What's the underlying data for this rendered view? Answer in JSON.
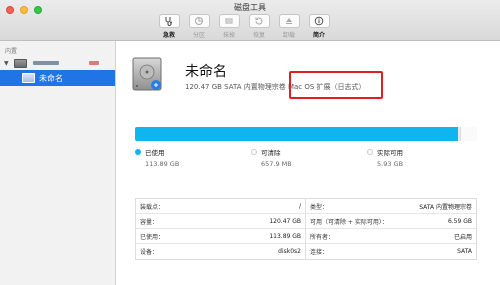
{
  "app": {
    "title": "磁盘工具"
  },
  "toolbar": {
    "buttons": [
      {
        "label": "急救",
        "icon": "stethoscope-icon",
        "enabled": true
      },
      {
        "label": "分区",
        "icon": "pie-chart-icon",
        "enabled": false
      },
      {
        "label": "抹掉",
        "icon": "erase-icon",
        "enabled": false
      },
      {
        "label": "恢复",
        "icon": "restore-icon",
        "enabled": false
      },
      {
        "label": "卸载",
        "icon": "eject-icon",
        "enabled": false
      },
      {
        "label": "简介",
        "icon": "info-icon",
        "enabled": true
      }
    ]
  },
  "sidebar": {
    "section_header": "内置",
    "volume_label": "未命名"
  },
  "volume": {
    "name": "未命名",
    "subtitle": "120.47 GB SATA 内置物理宗卷 Mac OS 扩展（日志式）"
  },
  "usage": {
    "capacity_gb": 120.47,
    "used_gb": 113.89,
    "purgeable_gb": 657.9,
    "available_gb": 5.93,
    "colors": {
      "used": "#10b5ef",
      "free": "#fafafa"
    },
    "legend": [
      {
        "label": "已使用",
        "value": "113.89 GB"
      },
      {
        "label": "可清除",
        "value": "657.9 MB"
      },
      {
        "label": "实际可用",
        "value": "5.93 GB"
      }
    ]
  },
  "info": {
    "rows": [
      {
        "left_key": "装载点：",
        "left_val": "/",
        "right_key": "类型：",
        "right_val": "SATA 内置物理宗卷"
      },
      {
        "left_key": "容量：",
        "left_val": "120.47 GB",
        "right_key": "可用（可清除 + 实际可用）：",
        "right_val": "6.59 GB"
      },
      {
        "left_key": "已使用：",
        "left_val": "113.89 GB",
        "right_key": "所有者：",
        "right_val": "已启用"
      },
      {
        "left_key": "设备：",
        "left_val": "disk0s2",
        "right_key": "连接：",
        "right_val": "SATA"
      }
    ]
  },
  "highlight": {
    "color": "#e02020"
  }
}
